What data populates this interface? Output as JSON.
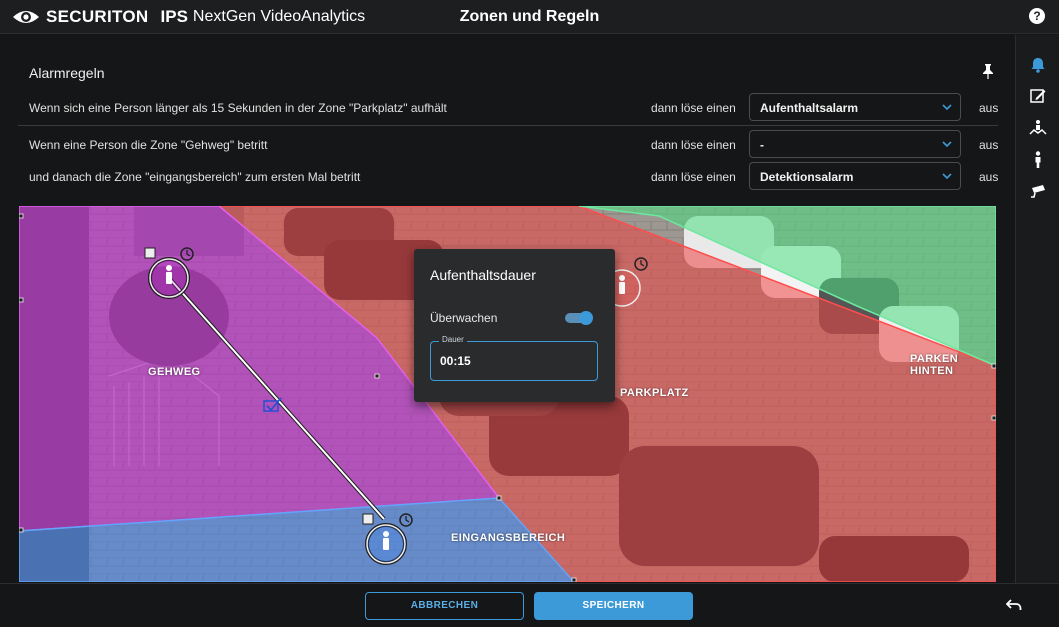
{
  "header": {
    "brand_main": "SECURITON",
    "brand_ips": "IPS",
    "brand_product": "NextGen VideoAnalytics",
    "page_title": "Zonen und Regeln",
    "help_icon": "help-icon"
  },
  "alarm_rules": {
    "title": "Alarmregeln",
    "pin_icon": "pin-icon",
    "rules": [
      {
        "text": "Wenn sich eine Person länger als 15 Sekunden in der Zone \"Parkplatz\" aufhält",
        "then": "dann löse einen",
        "selected": "Aufenthaltsalarm",
        "state": "aus"
      },
      {
        "text": "Wenn eine Person die Zone \"Gehweg\" betritt",
        "then": "dann löse einen",
        "selected": "-",
        "state": "aus"
      },
      {
        "text": "und danach die Zone \"eingangsbereich\" zum ersten Mal betritt",
        "then": "dann löse einen",
        "selected": "Detektionsalarm",
        "state": "aus"
      }
    ]
  },
  "sidebar": {
    "icons": [
      "bell-icon",
      "edit-icon",
      "zone-person-icon",
      "person-icon",
      "camera-icon"
    ]
  },
  "video": {
    "zones": [
      {
        "name": "GEHWEG",
        "color": "#c026d3"
      },
      {
        "name": "PARKPLATZ",
        "color": "#ef4444"
      },
      {
        "name": "EINGANGSBEREICH",
        "color": "#3b82f6"
      },
      {
        "name": "PARKEN HINTEN",
        "color": "#4ade80"
      }
    ]
  },
  "popup": {
    "title": "Aufenthaltsdauer",
    "monitor_label": "Überwachen",
    "monitor_on": true,
    "duration_label": "Dauer",
    "duration_value": "00:15"
  },
  "footer": {
    "cancel_label": "ABBRECHEN",
    "save_label": "SPEICHERN",
    "undo_icon": "undo-icon"
  },
  "colors": {
    "accent": "#3d9ad8",
    "background": "#151617"
  }
}
